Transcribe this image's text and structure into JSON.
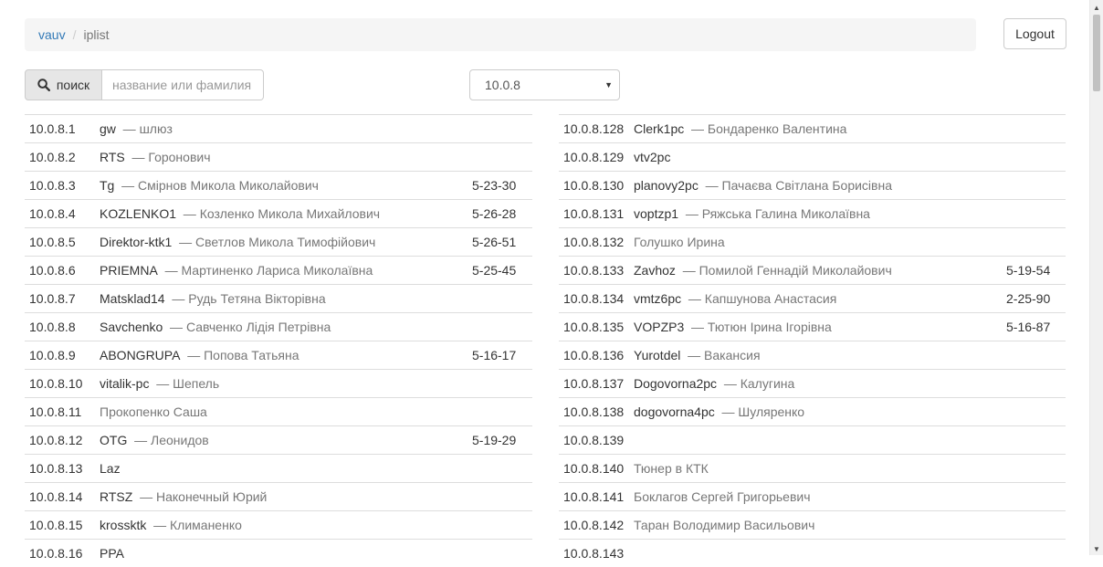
{
  "breadcrumb": {
    "home": "vauv",
    "separator": "/",
    "current": "iplist"
  },
  "header": {
    "logout_label": "Logout"
  },
  "search": {
    "button_label": "поиск",
    "icon": "search-icon",
    "placeholder": "название или фамилия",
    "value": ""
  },
  "subnet": {
    "selected": "10.0.8"
  },
  "left_rows": [
    {
      "ip": "10.0.8.1",
      "host": "gw",
      "owner": "шлюз",
      "phone": ""
    },
    {
      "ip": "10.0.8.2",
      "host": "RTS",
      "owner": "Горонович",
      "phone": ""
    },
    {
      "ip": "10.0.8.3",
      "host": "Tg",
      "owner": "Смірнов Микола Миколайович",
      "phone": "5-23-30"
    },
    {
      "ip": "10.0.8.4",
      "host": "KOZLENKO1",
      "owner": "Козленко Микола Михайлович",
      "phone": "5-26-28"
    },
    {
      "ip": "10.0.8.5",
      "host": "Direktor-ktk1",
      "owner": "Светлов Микола Тимофійович",
      "phone": "5-26-51"
    },
    {
      "ip": "10.0.8.6",
      "host": "PRIEMNA",
      "owner": "Мартиненко Лариса Миколаївна",
      "phone": "5-25-45"
    },
    {
      "ip": "10.0.8.7",
      "host": "Matsklad14",
      "owner": "Рудь Тетяна Вікторівна",
      "phone": ""
    },
    {
      "ip": "10.0.8.8",
      "host": "Savchenko",
      "owner": "Савченко Лідія Петрівна",
      "phone": ""
    },
    {
      "ip": "10.0.8.9",
      "host": "ABONGRUPA",
      "owner": "Попова Татьяна",
      "phone": "5-16-17"
    },
    {
      "ip": "10.0.8.10",
      "host": "vitalik-pc",
      "owner": "Шепель",
      "phone": ""
    },
    {
      "ip": "10.0.8.11",
      "host": "",
      "owner": "Прокопенко Саша",
      "phone": ""
    },
    {
      "ip": "10.0.8.12",
      "host": "OTG",
      "owner": "Леонидов",
      "phone": "5-19-29"
    },
    {
      "ip": "10.0.8.13",
      "host": "Laz",
      "owner": "",
      "phone": ""
    },
    {
      "ip": "10.0.8.14",
      "host": "RTSZ",
      "owner": "Наконечный Юрий",
      "phone": ""
    },
    {
      "ip": "10.0.8.15",
      "host": "krossktk",
      "owner": "Климаненко",
      "phone": ""
    },
    {
      "ip": "10.0.8.16",
      "host": "PPA",
      "owner": "",
      "phone": ""
    }
  ],
  "right_rows": [
    {
      "ip": "10.0.8.128",
      "host": "Clerk1pc",
      "owner": "Бондаренко Валентина",
      "phone": ""
    },
    {
      "ip": "10.0.8.129",
      "host": "vtv2pc",
      "owner": "",
      "phone": ""
    },
    {
      "ip": "10.0.8.130",
      "host": "planovy2pc",
      "owner": "Пачаєва Світлана Борисівна",
      "phone": ""
    },
    {
      "ip": "10.0.8.131",
      "host": "voptzp1",
      "owner": "Ряжська Галина Миколаївна",
      "phone": ""
    },
    {
      "ip": "10.0.8.132",
      "host": "",
      "owner": "Голушко Ирина",
      "phone": ""
    },
    {
      "ip": "10.0.8.133",
      "host": "Zavhoz",
      "owner": "Помилой Геннадій Миколайович",
      "phone": "5-19-54"
    },
    {
      "ip": "10.0.8.134",
      "host": "vmtz6pc",
      "owner": "Капшунова Анастасия",
      "phone": "2-25-90"
    },
    {
      "ip": "10.0.8.135",
      "host": "VOPZP3",
      "owner": "Тютюн Ірина Ігорівна",
      "phone": "5-16-87"
    },
    {
      "ip": "10.0.8.136",
      "host": "Yurotdel",
      "owner": "Вакансия",
      "phone": ""
    },
    {
      "ip": "10.0.8.137",
      "host": "Dogovorna2pc",
      "owner": "Калугина",
      "phone": ""
    },
    {
      "ip": "10.0.8.138",
      "host": "dogovorna4pc",
      "owner": "Шуляренко",
      "phone": ""
    },
    {
      "ip": "10.0.8.139",
      "host": "",
      "owner": "",
      "phone": ""
    },
    {
      "ip": "10.0.8.140",
      "host": "",
      "owner": "Тюнер в КТК",
      "phone": ""
    },
    {
      "ip": "10.0.8.141",
      "host": "",
      "owner": "Боклагов Сергей Григорьевич",
      "phone": ""
    },
    {
      "ip": "10.0.8.142",
      "host": "",
      "owner": "Таран Володимир Васильович",
      "phone": ""
    },
    {
      "ip": "10.0.8.143",
      "host": "",
      "owner": "",
      "phone": ""
    }
  ]
}
